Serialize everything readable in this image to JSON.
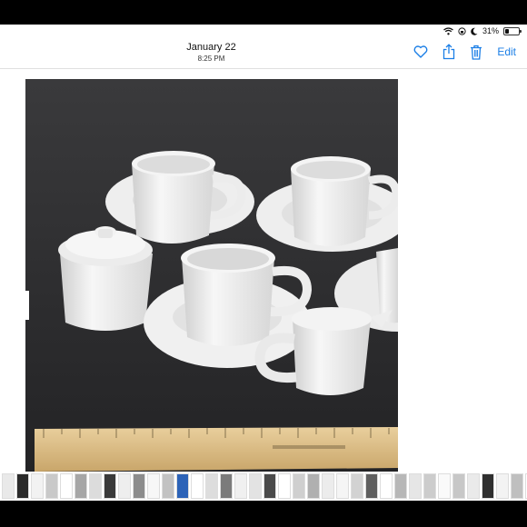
{
  "status": {
    "battery": "31%",
    "battery_level": 0.31
  },
  "header": {
    "date": "January 22",
    "time": "8:25 PM",
    "edit_label": "Edit"
  },
  "icons": {
    "favorite": "heart-icon",
    "share": "share-icon",
    "delete": "trash-icon",
    "wifi": "wifi-icon",
    "lock": "orientation-lock-icon",
    "moon": "moon-icon"
  },
  "colors": {
    "accent": "#1a7ee6",
    "photo_background": "#2d2d2f"
  },
  "thumbnails": [
    "#e9e9e9",
    "#2a2a2a",
    "#f2f2f2",
    "#c9c9c9",
    "#ffffff",
    "#a6a6a6",
    "#dcdcdc",
    "#3a3a3a",
    "#eeeeee",
    "#8c8c8c",
    "#f7f7f7",
    "#c2c2c2",
    "#2c63b8",
    "#ffffff",
    "#dddddd",
    "#7b7b7b",
    "#f0f0f0",
    "#e3e3e3",
    "#4a4a4a",
    "#ffffff",
    "#cfcfcf",
    "#b0b0b0",
    "#ececec",
    "#f5f5f5",
    "#d2d2d2",
    "#5f5f5f",
    "#ffffff",
    "#b7b7b7",
    "#e6e6e6",
    "#cccccc",
    "#fafafa",
    "#c7c7c7",
    "#eaeaea",
    "#2f2f2f",
    "#f3f3f3",
    "#bfbfbf",
    "#ffffff",
    "#d9d9d9",
    "#6a6a6a",
    "#f4f4f4"
  ]
}
